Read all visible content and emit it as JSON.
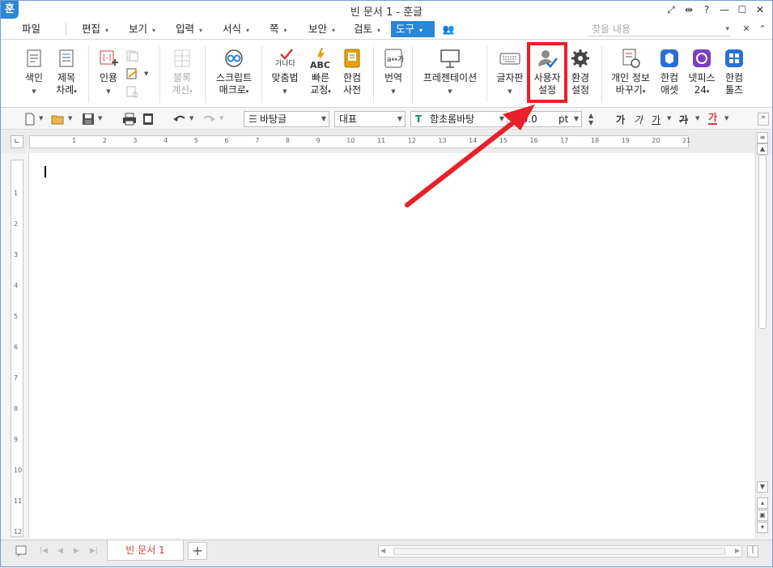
{
  "titlebar": {
    "app_logo": "훈",
    "title": "빈 문서 1 - 훈글",
    "controls": [
      "⤢",
      "⇹",
      "?",
      "—",
      "☐",
      "✕"
    ]
  },
  "menubar": {
    "items": [
      {
        "label": "파일"
      },
      {
        "label": "편집"
      },
      {
        "label": "보기"
      },
      {
        "label": "입력"
      },
      {
        "label": "서식"
      },
      {
        "label": "쪽"
      },
      {
        "label": "보안"
      },
      {
        "label": "검토"
      },
      {
        "label": "도구"
      }
    ],
    "find_placeholder": "찾을 내용"
  },
  "ribbon": {
    "buttons": [
      {
        "line1": "색인",
        "line2": ""
      },
      {
        "line1": "제목",
        "line2": "차례"
      },
      {
        "line1": "인용",
        "line2": ""
      },
      {
        "line1": "블록",
        "line2": "계산"
      },
      {
        "line1": "스크립트",
        "line2": "매크로"
      },
      {
        "line1": "맞춤법",
        "line2": ""
      },
      {
        "line1": "빠른",
        "line2": "교정"
      },
      {
        "line1": "한컴",
        "line2": "사전"
      },
      {
        "line1": "번역",
        "line2": ""
      },
      {
        "line1": "프레젠테이션",
        "line2": ""
      },
      {
        "line1": "글자판",
        "line2": ""
      },
      {
        "line1": "사용자",
        "line2": "설정"
      },
      {
        "line1": "환경",
        "line2": "설정"
      },
      {
        "line1": "개인 정보",
        "line2": "바꾸기"
      },
      {
        "line1": "한컴",
        "line2": "애셋"
      },
      {
        "line1": "넷피스",
        "line2": "24"
      },
      {
        "line1": "한컴",
        "line2": "툴즈"
      }
    ],
    "icon_text": {
      "spell": "가나다",
      "abc": "ABC",
      "translate": "a↔가"
    }
  },
  "toolbar2": {
    "style_value": "바탕글",
    "lang_value": "대표",
    "font_value": "함초롬바탕",
    "size_value": "10.0",
    "size_unit": "pt",
    "format_buttons": [
      "가",
      "가",
      "가",
      "가",
      "가"
    ]
  },
  "ruler": {
    "numbers": [
      "1",
      "2",
      "3",
      "4",
      "5",
      "6",
      "7",
      "8",
      "9",
      "10",
      "11",
      "12",
      "13",
      "14",
      "15",
      "16",
      "17",
      "18",
      "19",
      "20",
      "21"
    ],
    "vnumbers": [
      "1",
      "2",
      "3",
      "4",
      "5",
      "6",
      "7",
      "8",
      "9",
      "10",
      "11",
      "12"
    ]
  },
  "bottombar": {
    "tab_label": "빈 문서 1",
    "add_label": "+"
  }
}
